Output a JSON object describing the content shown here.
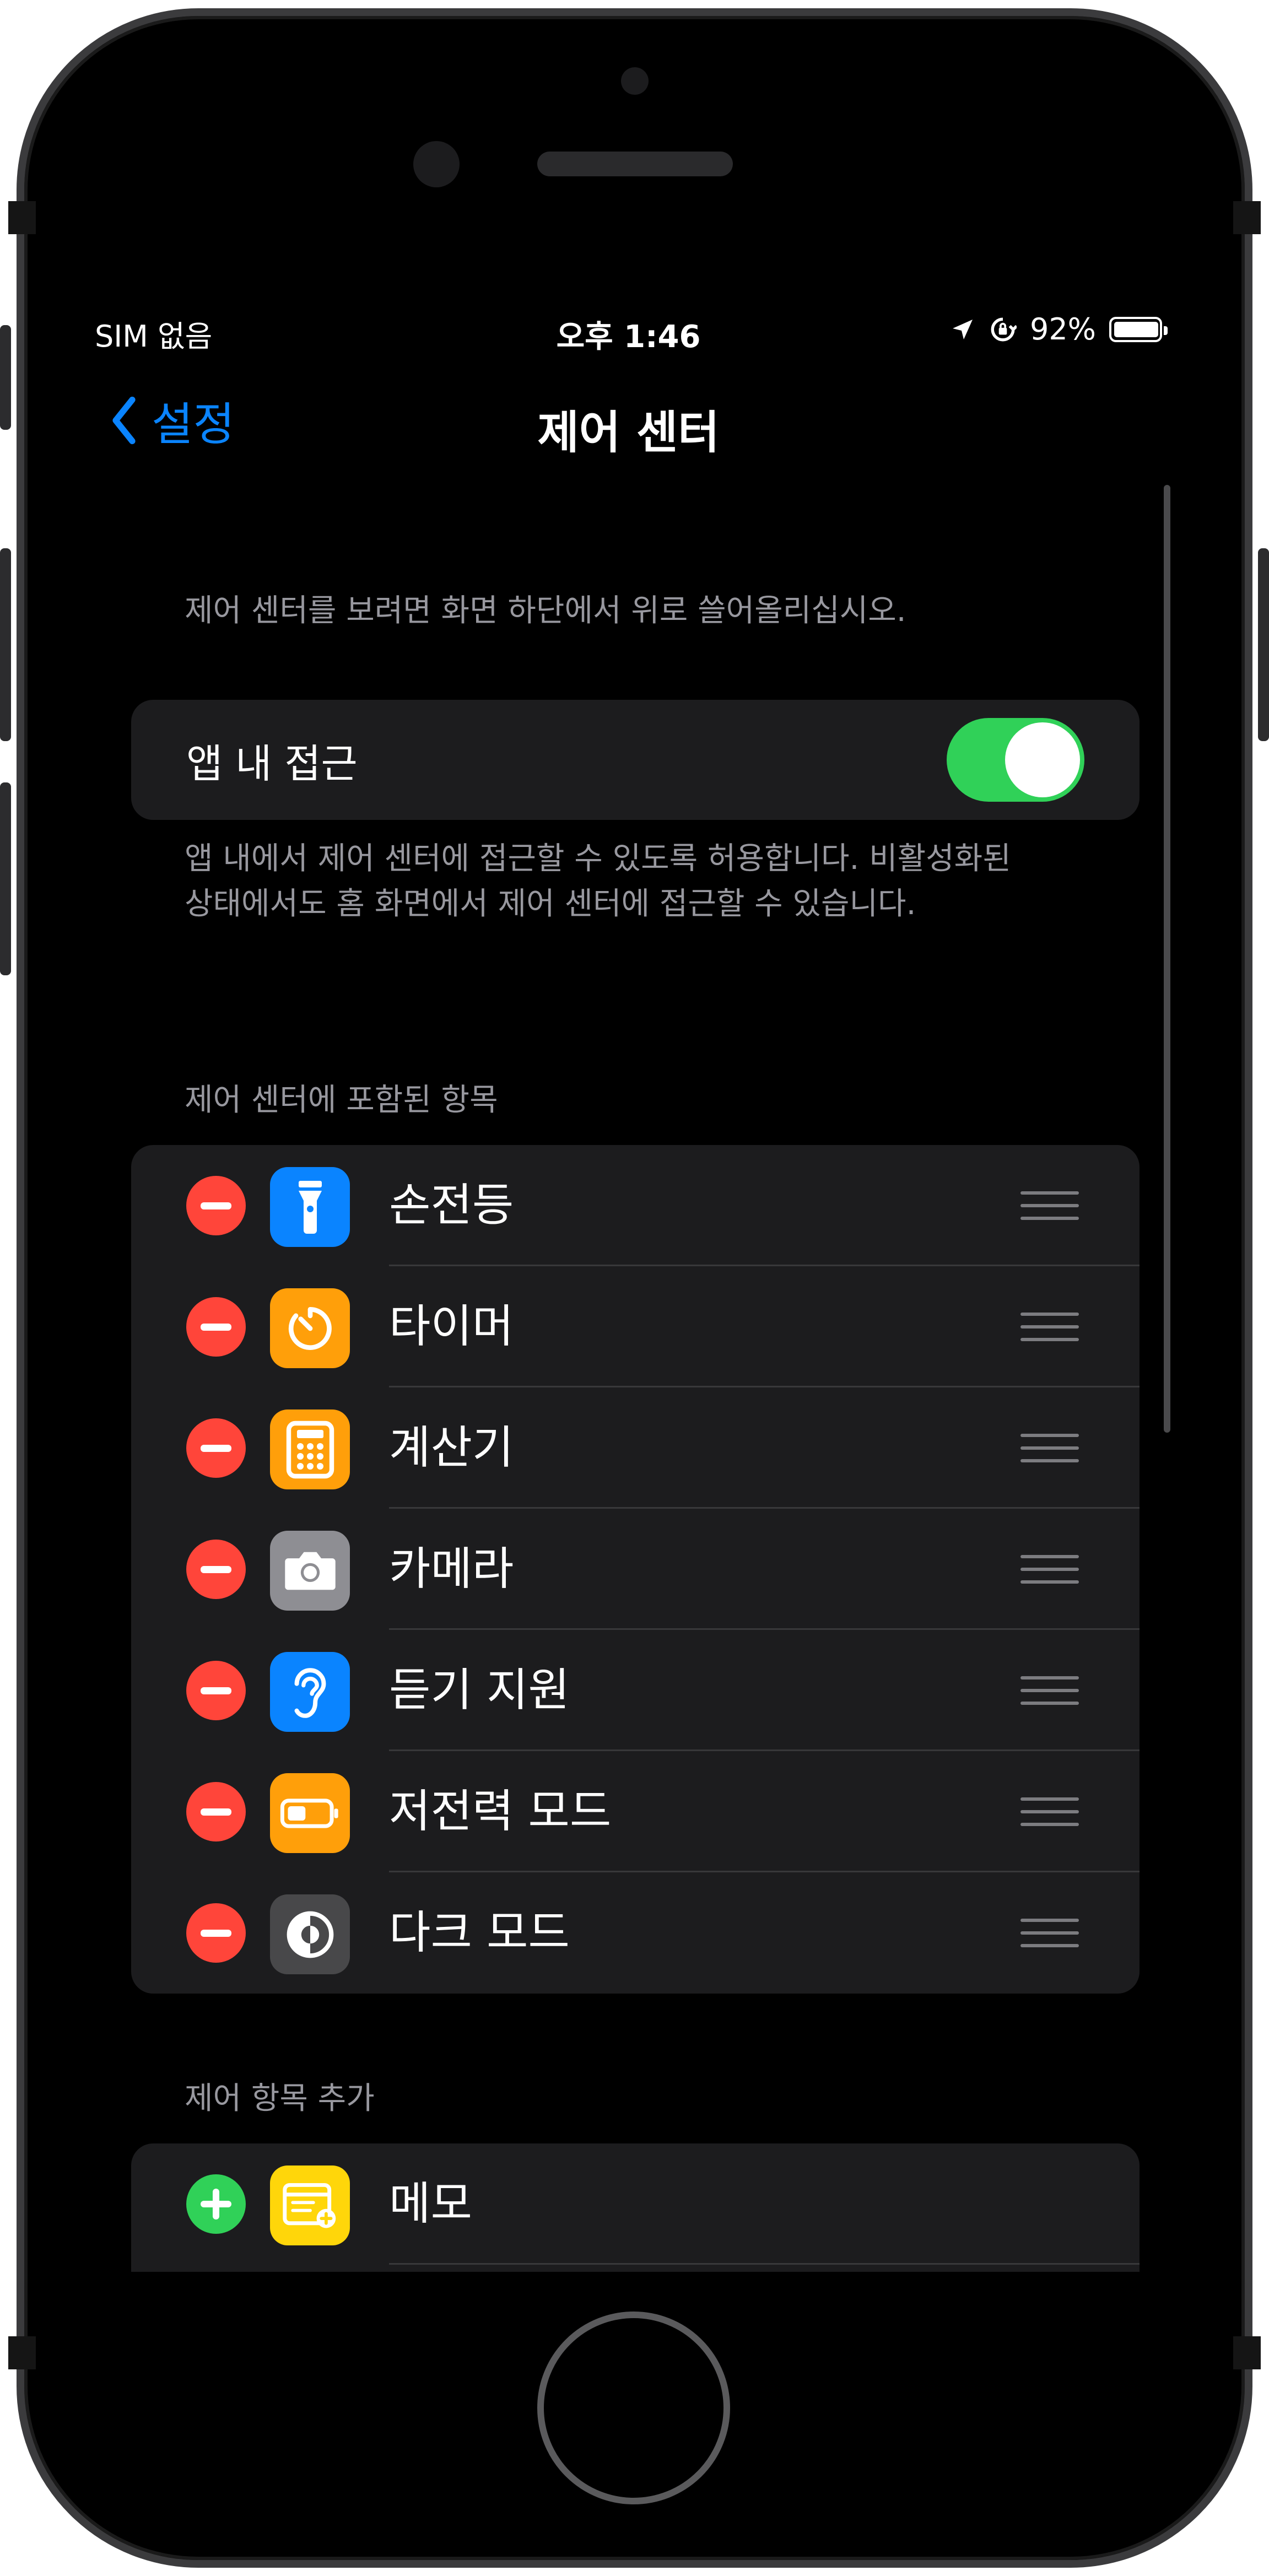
{
  "status_bar": {
    "carrier": "SIM 없음",
    "time": "오후 1:46",
    "battery_percent": "92%",
    "battery_level": 0.92,
    "icons": [
      "location-arrow-icon",
      "orientation-lock-icon",
      "battery-icon"
    ]
  },
  "nav": {
    "back_label": "설정",
    "title": "제어 센터"
  },
  "intro_hint": "제어 센터를 보려면 화면 하단에서 위로 쓸어올리십시오.",
  "access": {
    "label": "앱 내 접근",
    "enabled": true,
    "footer_line1": "앱 내에서 제어 센터에 접근할 수 있도록 허용합니다. 비활성화된",
    "footer_line2": "상태에서도 홈 화면에서 제어 센터에 접근할 수 있습니다."
  },
  "included": {
    "header": "제어 센터에 포함된 항목",
    "items": [
      {
        "label": "손전등",
        "icon": "flashlight-icon",
        "color": "#0a84ff"
      },
      {
        "label": "타이머",
        "icon": "timer-icon",
        "color": "#ff9f0a"
      },
      {
        "label": "계산기",
        "icon": "calculator-icon",
        "color": "#ff9f0a"
      },
      {
        "label": "카메라",
        "icon": "camera-icon",
        "color": "#8e8e93"
      },
      {
        "label": "듣기 지원",
        "icon": "ear-icon",
        "color": "#0a84ff"
      },
      {
        "label": "저전력 모드",
        "icon": "low-power-battery-icon",
        "color": "#ff9f0a"
      },
      {
        "label": "다크 모드",
        "icon": "dark-mode-icon",
        "color": "#48484a"
      }
    ]
  },
  "more": {
    "header": "제어 항목 추가",
    "items": [
      {
        "label": "메모",
        "icon": "notes-icon",
        "color": "#ffd60a"
      }
    ]
  }
}
